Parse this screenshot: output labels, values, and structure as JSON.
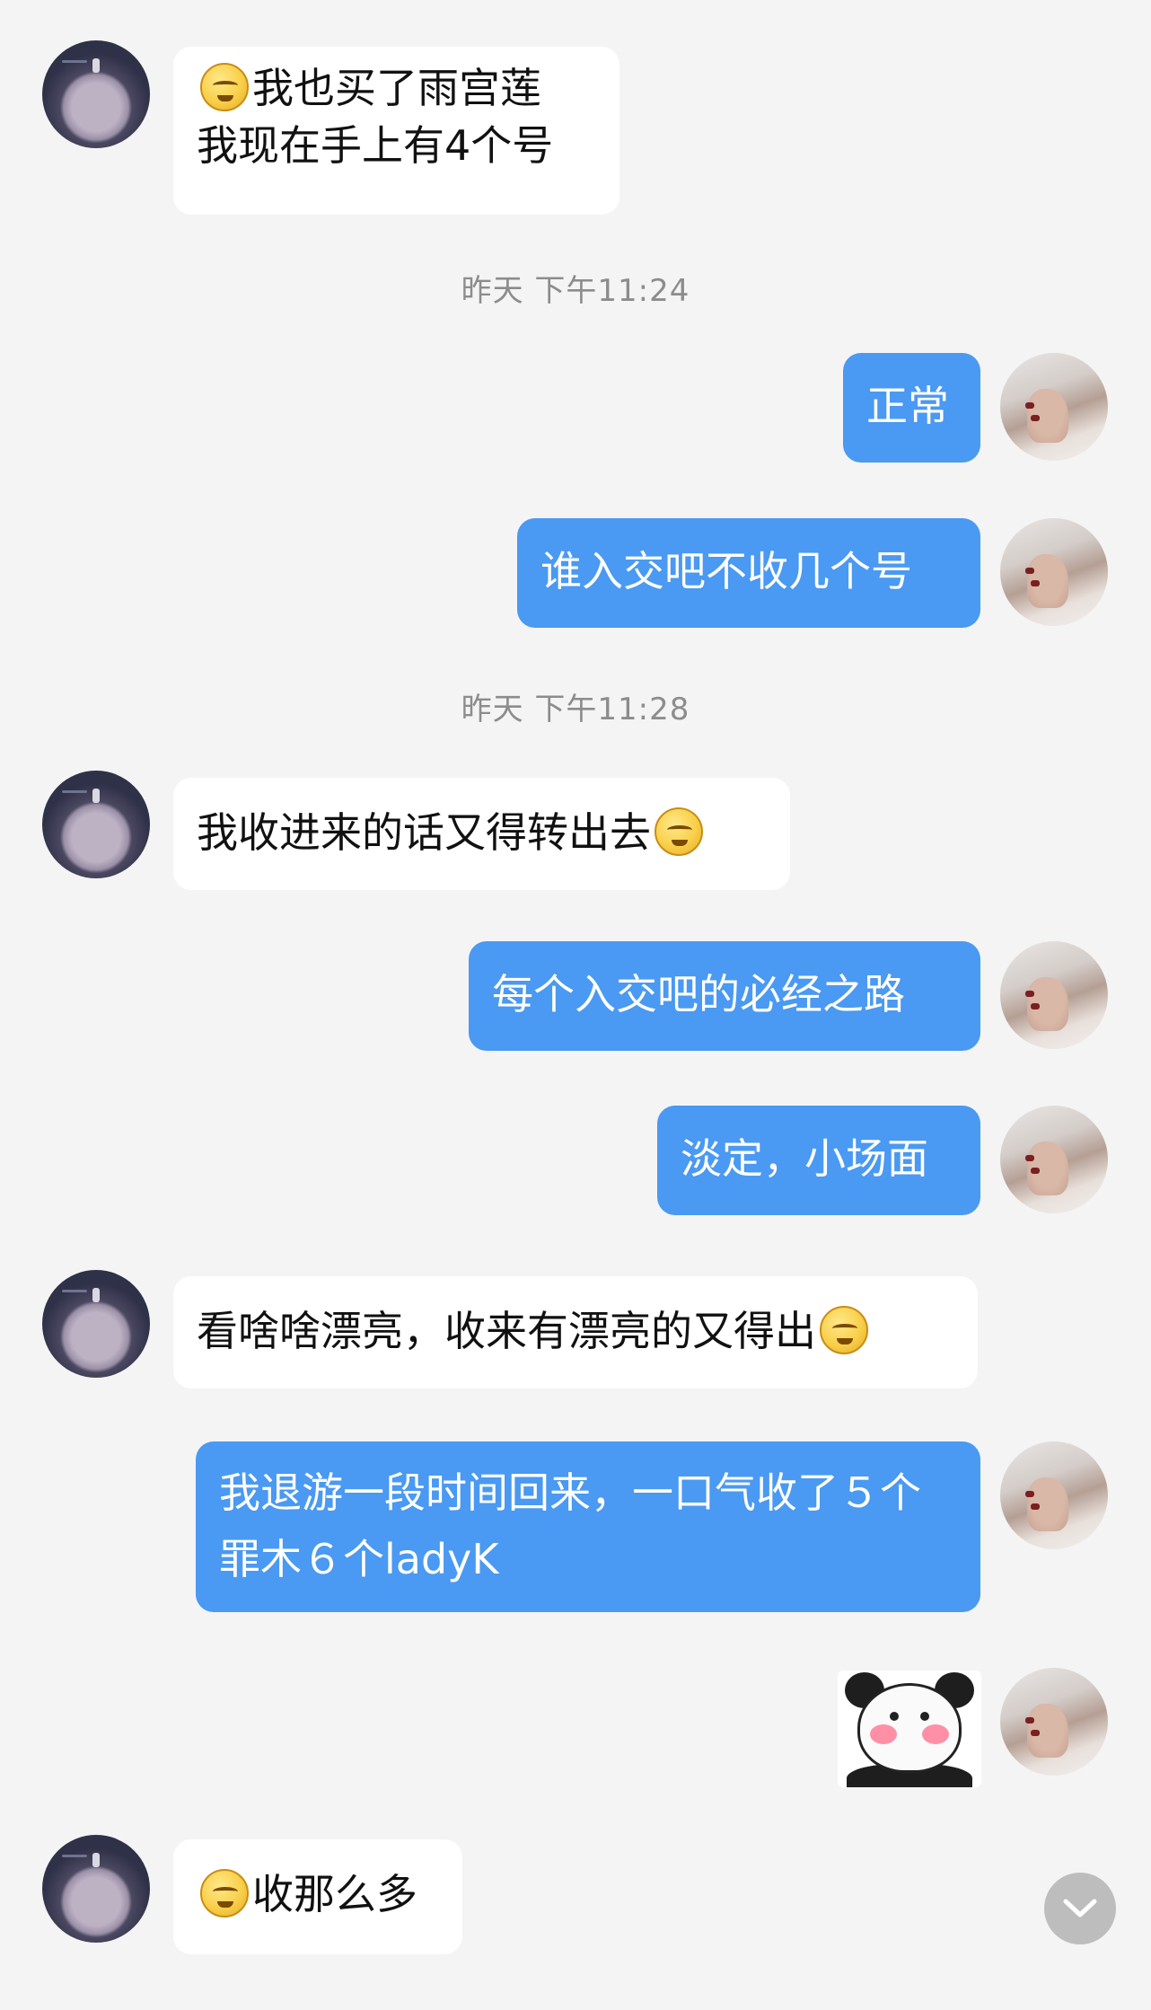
{
  "timestamps": [
    "昨天 下午11:24",
    "昨天 下午11:28"
  ],
  "messages": [
    {
      "side": "in",
      "lines": [
        "我也买了雨宫莲",
        "我现在手上有4个号"
      ],
      "emoji": "smirk-emoji"
    },
    {
      "side": "out",
      "text": "正常"
    },
    {
      "side": "out",
      "text": "谁入交吧不收几个号"
    },
    {
      "side": "in",
      "text": "我收进来的话又得转出去",
      "emoji": "shush-emoji"
    },
    {
      "side": "out",
      "text": "每个入交吧的必经之路"
    },
    {
      "side": "out",
      "text": "淡定，小场面"
    },
    {
      "side": "in",
      "text": "看啥啥漂亮，收来有漂亮的又得出",
      "emoji": "shush-emoji"
    },
    {
      "side": "out",
      "text": "我退游一段时间回来，一口气收了５个罪木６个ladyK"
    },
    {
      "side": "out",
      "sticker": "panda-blush-sticker"
    },
    {
      "side": "in",
      "text": "收那么多",
      "emoji": "laugh-emoji"
    }
  ],
  "colors": {
    "outgoing_bubble": "#4a99f2",
    "incoming_bubble": "#ffffff",
    "background": "#f4f4f4"
  },
  "icons": {
    "scroll_down": "chevron-down-icon"
  }
}
